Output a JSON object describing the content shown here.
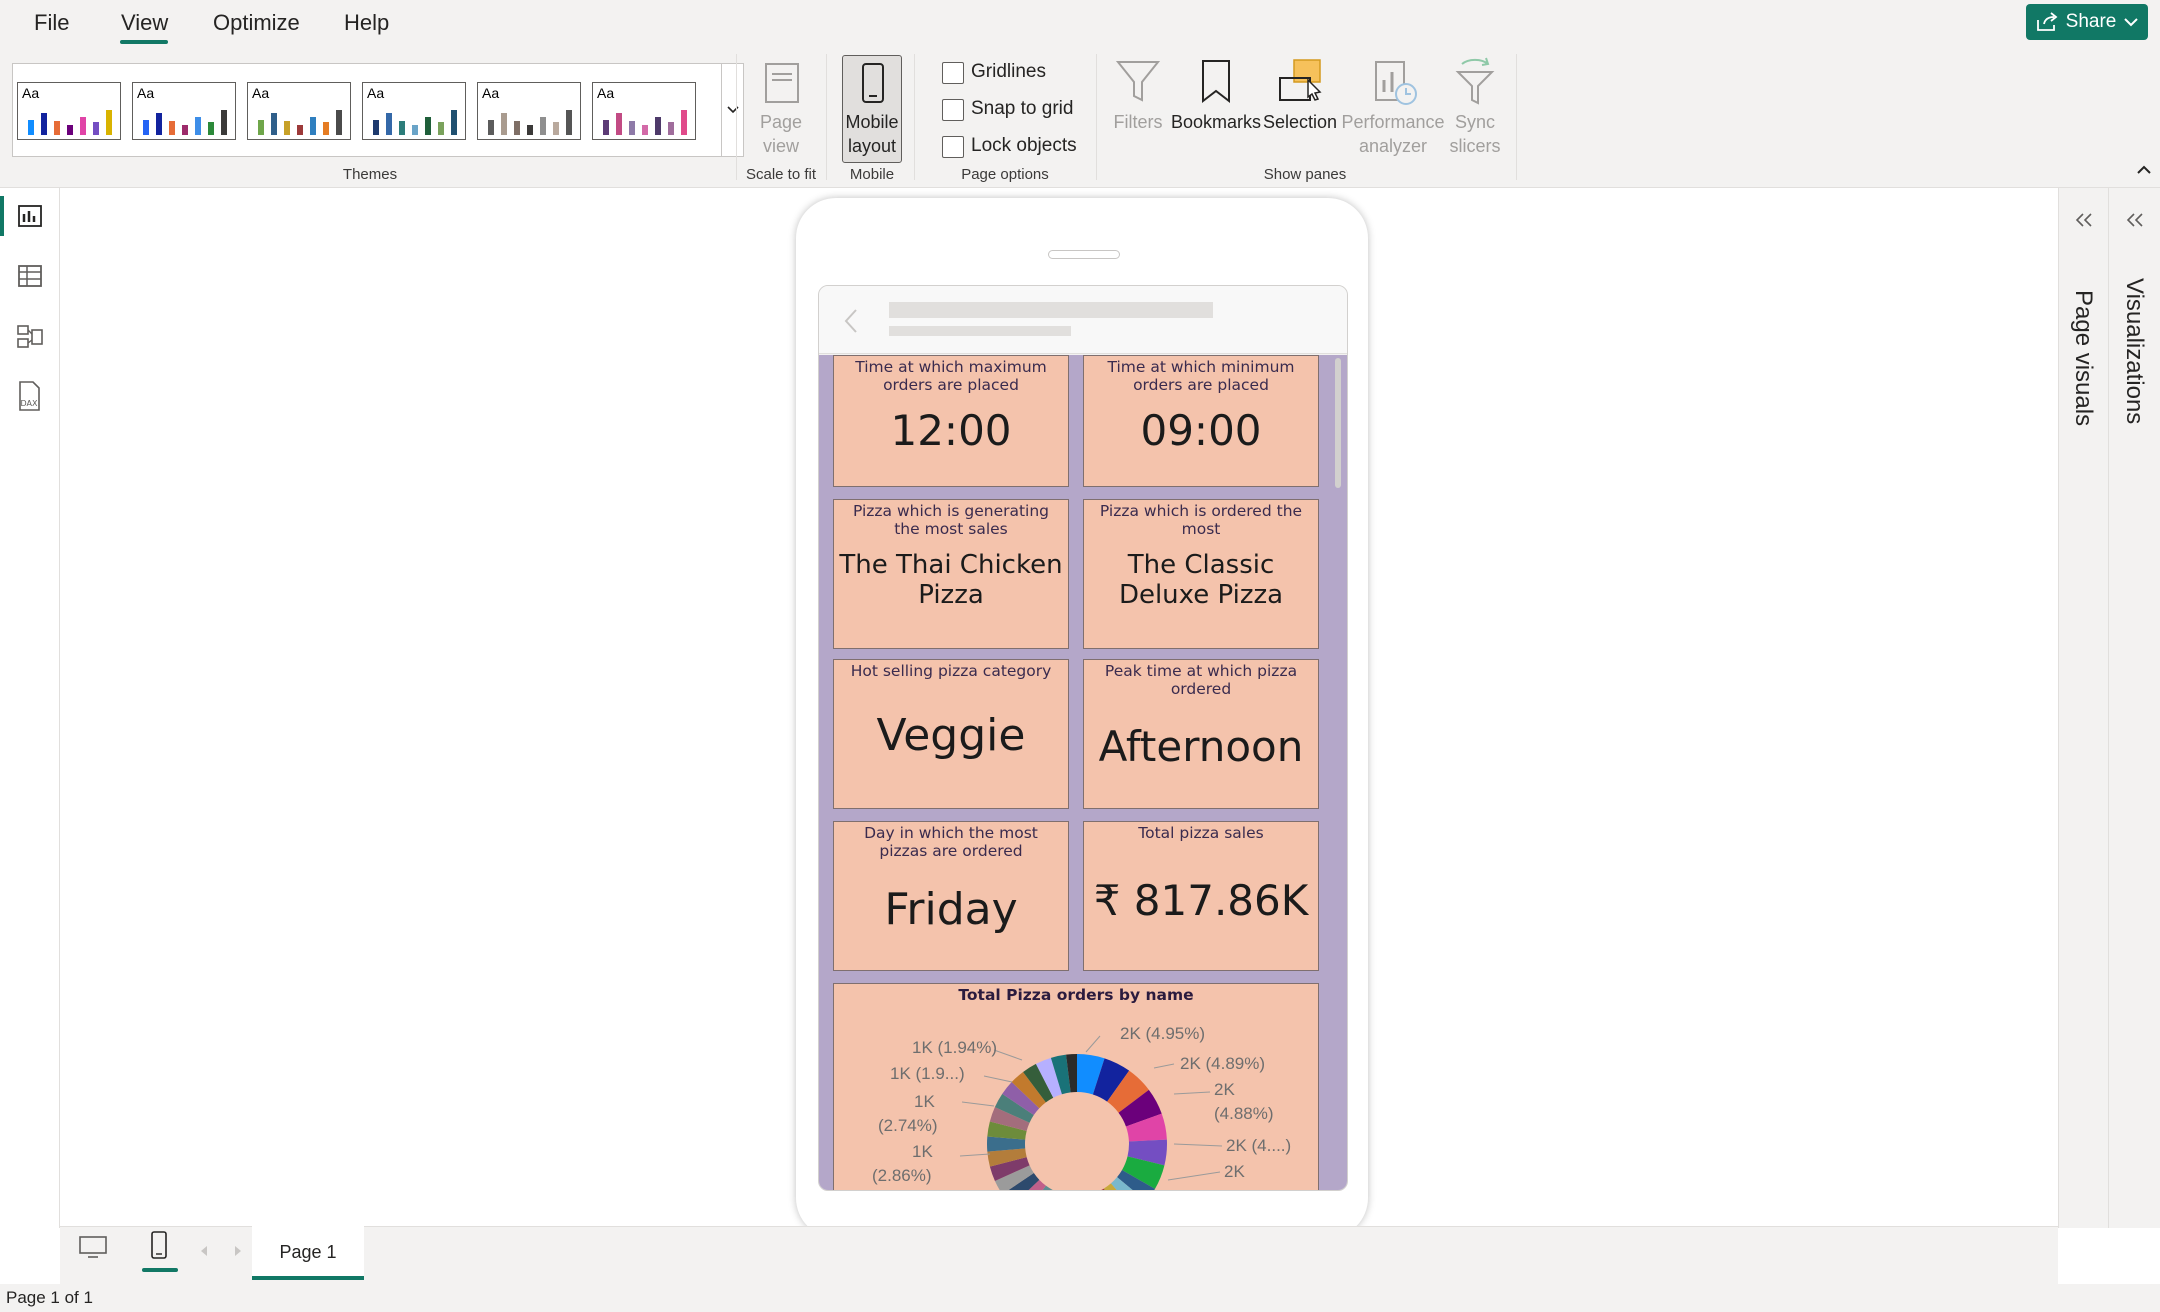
{
  "menu": {
    "tabs": [
      {
        "label": "File"
      },
      {
        "label": "View"
      },
      {
        "label": "Optimize"
      },
      {
        "label": "Help"
      }
    ],
    "share_label": "Share"
  },
  "ribbon": {
    "themes_label": "Themes",
    "themes": [
      {
        "colors": [
          "#118dff",
          "#12239e",
          "#e66c37",
          "#6b007b",
          "#e044a7",
          "#744ec2",
          "#d9b300"
        ]
      },
      {
        "colors": [
          "#2564f5",
          "#12239e",
          "#e66c37",
          "#9d2b6b",
          "#3e8ee8",
          "#2c8a3a",
          "#3b3a39"
        ]
      },
      {
        "colors": [
          "#6fa64a",
          "#2f5f8a",
          "#c7a128",
          "#9d3a3a",
          "#2f7fbf",
          "#e57c23",
          "#4b4b4b"
        ]
      },
      {
        "colors": [
          "#1e3a6e",
          "#3468a8",
          "#2c7d7a",
          "#6aa4c8",
          "#1f5f3a",
          "#7aa25c",
          "#205070"
        ]
      },
      {
        "colors": [
          "#5c5c5c",
          "#a99b8f",
          "#7f6f66",
          "#3b3a39",
          "#8f8f8f",
          "#b9a99d",
          "#555555"
        ]
      },
      {
        "colors": [
          "#5c3b76",
          "#c24b84",
          "#8e7aa8",
          "#d36aa8",
          "#4e3a6a",
          "#a06d9c",
          "#e04a8a"
        ]
      }
    ],
    "page_view": "Page view",
    "scale_to_fit": "Scale to fit",
    "mobile_layout_line1": "Mobile",
    "mobile_layout_line2": "layout",
    "mobile_label": "Mobile",
    "gridlines": "Gridlines",
    "snap_to_grid": "Snap to grid",
    "lock_objects": "Lock objects",
    "page_options_label": "Page options",
    "filters": "Filters",
    "bookmarks": "Bookmarks",
    "selection": "Selection",
    "performance_line1": "Performance",
    "performance_line2": "analyzer",
    "sync_line1": "Sync",
    "sync_line2": "slicers",
    "show_panes_label": "Show panes"
  },
  "panes": {
    "page_visuals": "Page visuals",
    "visualizations": "Visualizations"
  },
  "cards": [
    {
      "title": "Time at which maximum orders are placed",
      "value": "12:00"
    },
    {
      "title": "Time at which minimum orders are placed",
      "value": "09:00"
    },
    {
      "title": "Pizza which is generating the most sales",
      "value_line1": "The Thai Chicken",
      "value_line2": "Pizza"
    },
    {
      "title": "Pizza which is ordered the most",
      "value_line1": "The Classic",
      "value_line2": "Deluxe Pizza"
    },
    {
      "title": "Hot selling pizza category",
      "value": "Veggie"
    },
    {
      "title": "Peak time at which pizza ordered",
      "value": "Afternoon"
    },
    {
      "title": "Day in which the most pizzas are ordered",
      "value": "Friday"
    },
    {
      "title": "Total pizza sales",
      "value": "₹ 817.86K"
    }
  ],
  "donut": {
    "title": "Total Pizza orders by name",
    "labels": [
      "2K (4.95%)",
      "2K (4.89%)",
      "2K",
      "(4.88%)",
      "2K (4....)",
      "2K",
      "1K (1.94%)",
      "1K (1.9...)",
      "1K",
      "(2.74%)",
      "1K",
      "(2.86%)"
    ]
  },
  "chart_data": {
    "type": "pie",
    "title": "Total Pizza orders by name",
    "slices": [
      {
        "label": "2K",
        "percent": 4.95,
        "color": "#118dff"
      },
      {
        "label": "2K",
        "percent": 4.89,
        "color": "#12239e"
      },
      {
        "label": "2K",
        "percent": 4.88,
        "color": "#e66c37"
      },
      {
        "label": "2K",
        "percent": 4.8,
        "color": "#6b007b"
      },
      {
        "label": "2K",
        "percent": 4.7,
        "color": "#e044a7"
      },
      {
        "label": "",
        "percent": 4.6,
        "color": "#744ec2"
      },
      {
        "label": "",
        "percent": 4.5,
        "color": "#1aab40"
      },
      {
        "label": "1K",
        "percent": 2.86,
        "color": "#b6b0ff"
      },
      {
        "label": "1K",
        "percent": 2.74,
        "color": "#197278"
      },
      {
        "label": "1K",
        "percent": 1.94,
        "color": "#2b2b2b"
      }
    ]
  },
  "bottom": {
    "page_tab": "Page 1",
    "status": "Page 1 of 1"
  }
}
